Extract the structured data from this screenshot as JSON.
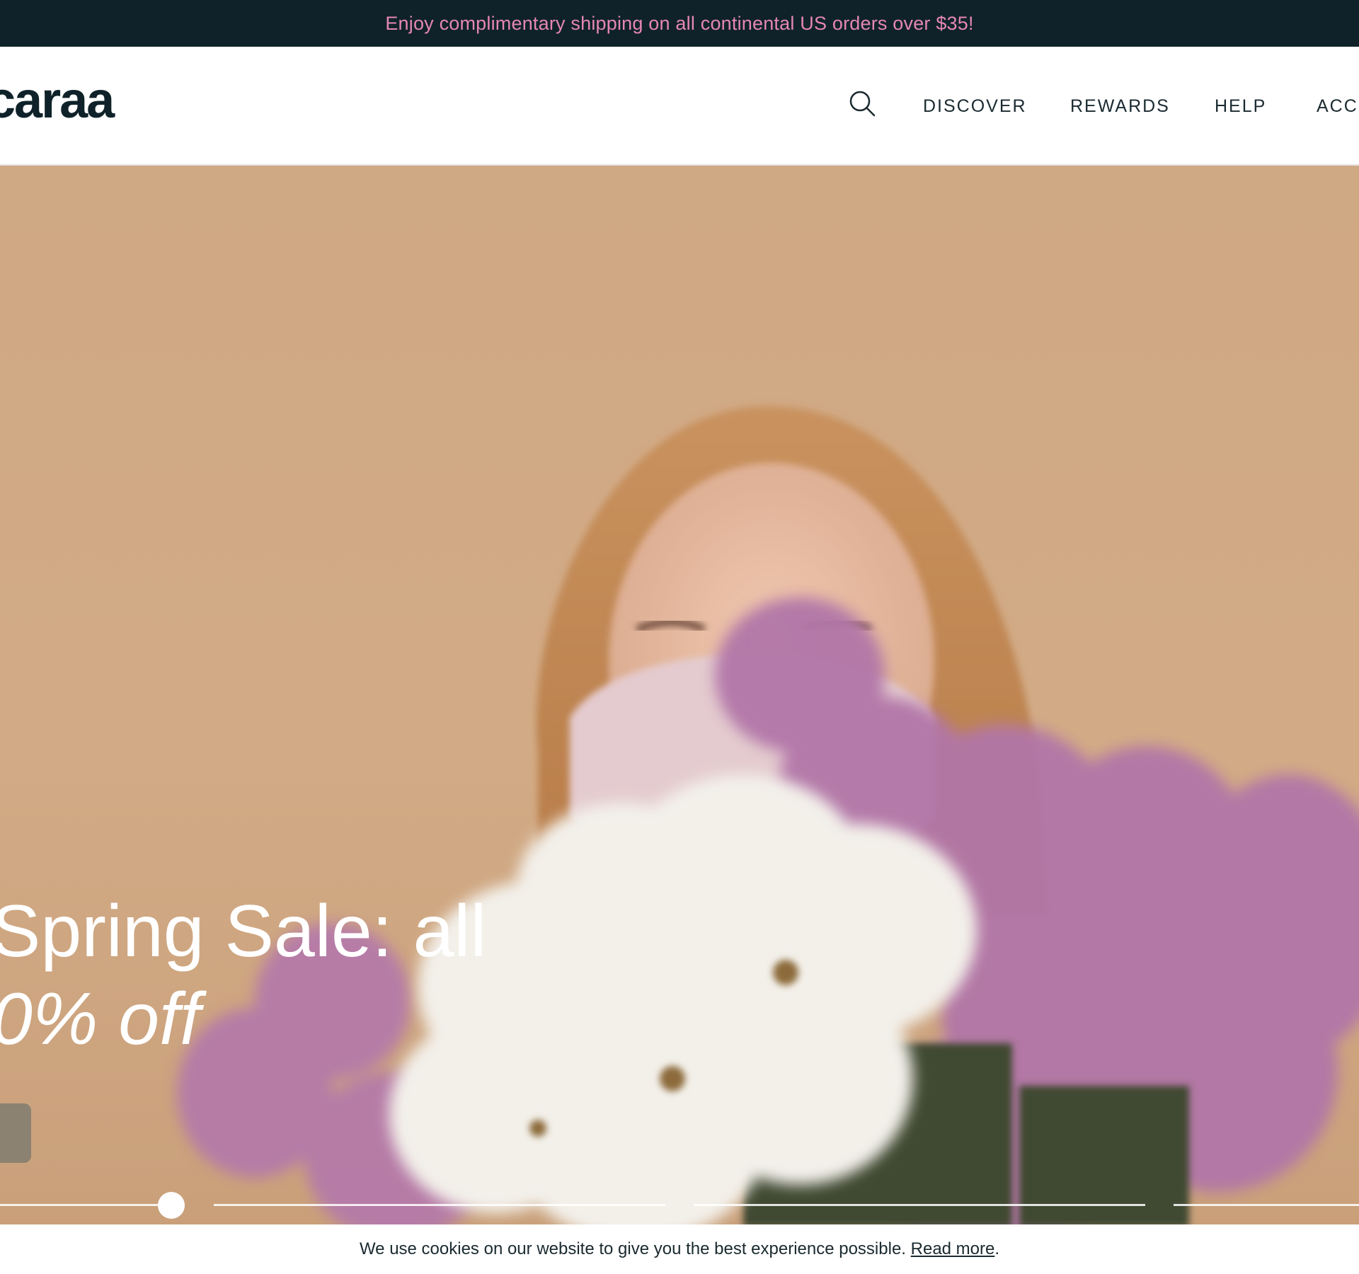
{
  "announcement": {
    "text": "Enjoy complimentary shipping on all continental US orders over $35!",
    "color": "#e587b6",
    "background": "#0f2229"
  },
  "header": {
    "logo_text": "caraa",
    "search_icon": "search-icon",
    "nav": {
      "discover": "DISCOVER",
      "rewards": "REWARDS",
      "help": "HELP",
      "account": "ACCE"
    }
  },
  "hero": {
    "headline_line1": "Spring Sale: all",
    "headline_line2": "0% off",
    "background_color": "#d2ab86",
    "cta_color": "#8c8272",
    "slides_count": 4,
    "active_slide": 1
  },
  "cookie_bar": {
    "text": "We use cookies on our website to give you the best experience possible.",
    "link": "Read more",
    "suffix": "."
  }
}
